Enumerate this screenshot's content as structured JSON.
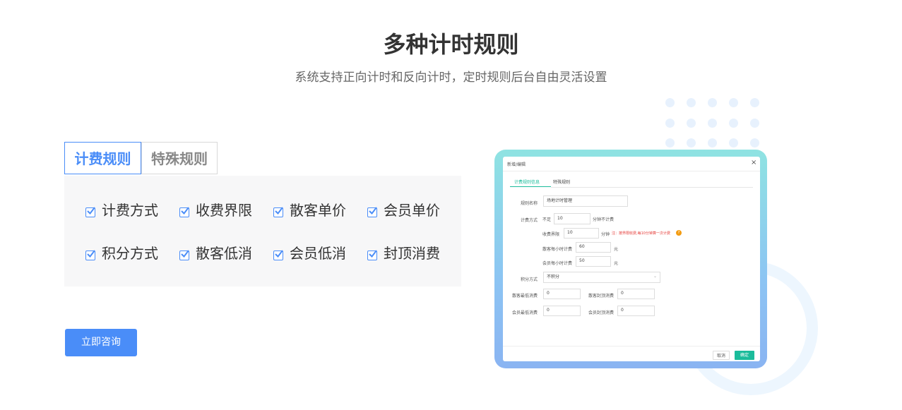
{
  "heading": {
    "title": "多种计时规则",
    "subtitle": "系统支持正向计时和反向计时，定时规则后台自由灵活设置"
  },
  "tabs": [
    {
      "label": "计费规则",
      "active": true
    },
    {
      "label": "特殊规则",
      "active": false
    }
  ],
  "features": [
    {
      "label": "计费方式",
      "checked": true
    },
    {
      "label": "收费界限",
      "checked": true
    },
    {
      "label": "散客单价",
      "checked": true
    },
    {
      "label": "会员单价",
      "checked": true
    },
    {
      "label": "积分方式",
      "checked": true
    },
    {
      "label": "散客低消",
      "checked": true
    },
    {
      "label": "会员低消",
      "checked": true
    },
    {
      "label": "封顶消费",
      "checked": true
    }
  ],
  "cta_label": "立即咨询",
  "colors": {
    "accent": "#4a8df8",
    "confirm": "#1bbc9b",
    "warning": "#e53935"
  },
  "dialog": {
    "title": "新增/编辑",
    "close": "×",
    "tab_active": "计费规则信息",
    "tab_other": "特殊规则",
    "rule_name_label": "规则名称",
    "rule_name_value": "场地计时管理",
    "billing_label": "计费方式",
    "billing_prefix": "不足",
    "billing_value": "10",
    "billing_suffix": "分钟不计费",
    "limit_label": "收费界限",
    "limit_value": "10",
    "limit_unit": "分钟",
    "limit_note": "注：按界限收费,每10分钟算一次计费",
    "guest_hourly_label": "散客每小时计费",
    "guest_hourly_value": "60",
    "guest_hourly_unit": "元",
    "member_hourly_label": "会员每小时计费",
    "member_hourly_value": "50",
    "member_hourly_unit": "元",
    "points_label": "积分方式",
    "points_value": "不积分",
    "guest_min_label": "散客最低消费",
    "guest_min_value": "0",
    "guest_cap_label": "散客封顶消费",
    "guest_cap_value": "0",
    "member_min_label": "会员最低消费",
    "member_min_value": "0",
    "member_cap_label": "会员封顶消费",
    "member_cap_value": "0",
    "cancel_label": "取消",
    "confirm_label": "确定"
  }
}
